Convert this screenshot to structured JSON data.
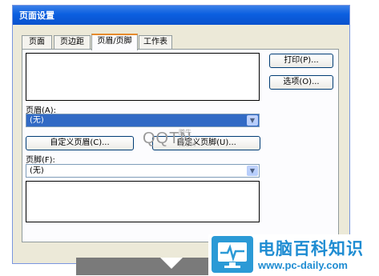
{
  "window": {
    "title": "页面设置"
  },
  "tabs": [
    {
      "label": "页面",
      "active": false
    },
    {
      "label": "页边距",
      "active": false
    },
    {
      "label": "页眉/页脚",
      "active": true
    },
    {
      "label": "工作表",
      "active": false
    }
  ],
  "buttons": {
    "print": "打印(P)...",
    "options": "选项(O)...",
    "custom_header": "自定义页眉(C)...",
    "custom_footer": "自定义页脚(U)..."
  },
  "header": {
    "label": "页眉(A):",
    "value": "(无)"
  },
  "footer": {
    "label": "页脚(F):",
    "value": "(无)"
  },
  "watermark": {
    "mark": "QQTN",
    "site_cn": "腾牛网",
    "site_en": ".COM"
  },
  "brand": {
    "name": "电脑百科知识",
    "url": "www.pc-daily.com",
    "color": "#1e8cd2"
  },
  "colors": {
    "title_bar": "#0b5fe0",
    "dialog_bg": "#ece9d8",
    "selection": "#316ac5",
    "active_tab_accent": "#e68b2c"
  }
}
